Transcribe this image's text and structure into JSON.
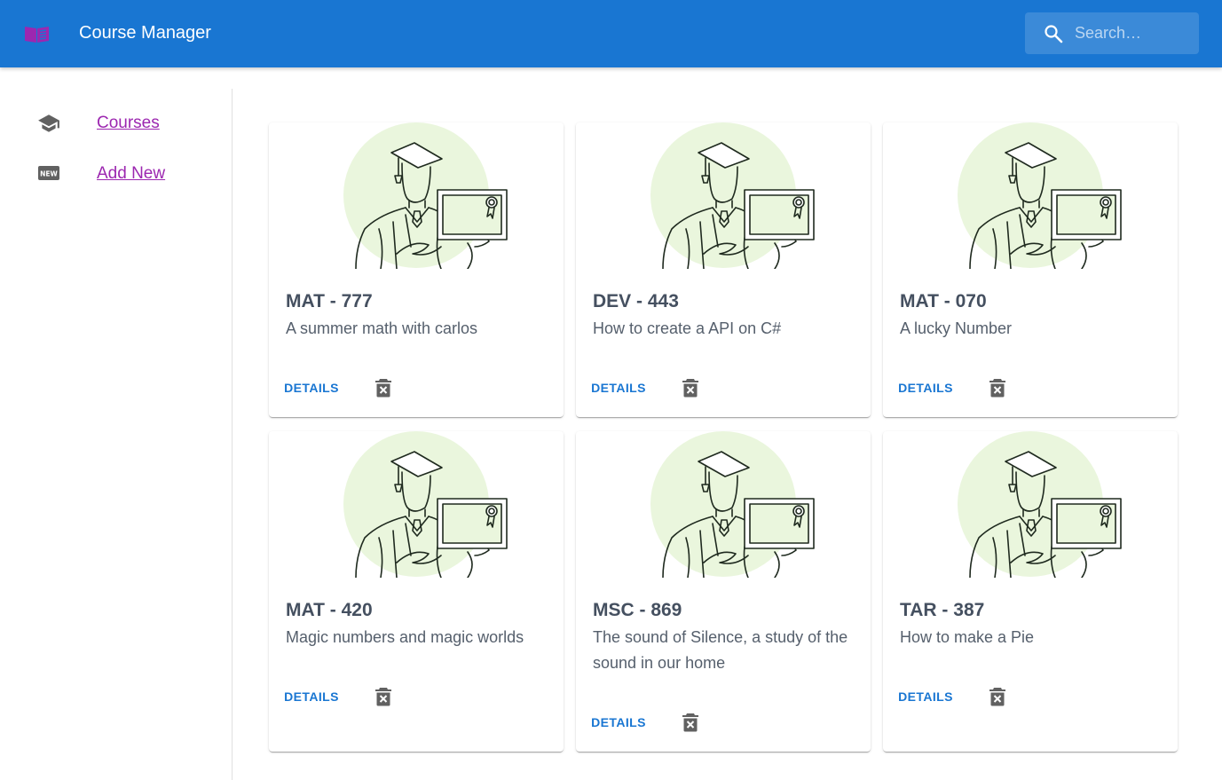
{
  "app": {
    "title": "Course Manager",
    "logo_icon": "book-icon",
    "brand_color": "#1976d2",
    "logo_color": "#9c27b0"
  },
  "search": {
    "placeholder": "Search…",
    "value": "",
    "icon": "search-icon"
  },
  "sidebar": {
    "items": [
      {
        "label": "Courses",
        "icon": "school-icon"
      },
      {
        "label": "Add New",
        "icon": "new-badge-icon"
      }
    ]
  },
  "courses": [
    {
      "code": "MAT - 777",
      "description": "A summer math with carlos",
      "details_label": "DETAILS",
      "delete_icon": "delete-forever-icon"
    },
    {
      "code": "DEV - 443",
      "description": "How to create a API on C#",
      "details_label": "DETAILS",
      "delete_icon": "delete-forever-icon"
    },
    {
      "code": "MAT - 070",
      "description": "A lucky Number",
      "details_label": "DETAILS",
      "delete_icon": "delete-forever-icon"
    },
    {
      "code": "MAT - 420",
      "description": "Magic numbers and magic worlds",
      "details_label": "DETAILS",
      "delete_icon": "delete-forever-icon"
    },
    {
      "code": "MSC - 869",
      "description": "The sound of Silence, a study of the sound in our home",
      "details_label": "DETAILS",
      "delete_icon": "delete-forever-icon"
    },
    {
      "code": "TAR - 387",
      "description": "How to make a Pie",
      "details_label": "DETAILS",
      "delete_icon": "delete-forever-icon"
    }
  ]
}
